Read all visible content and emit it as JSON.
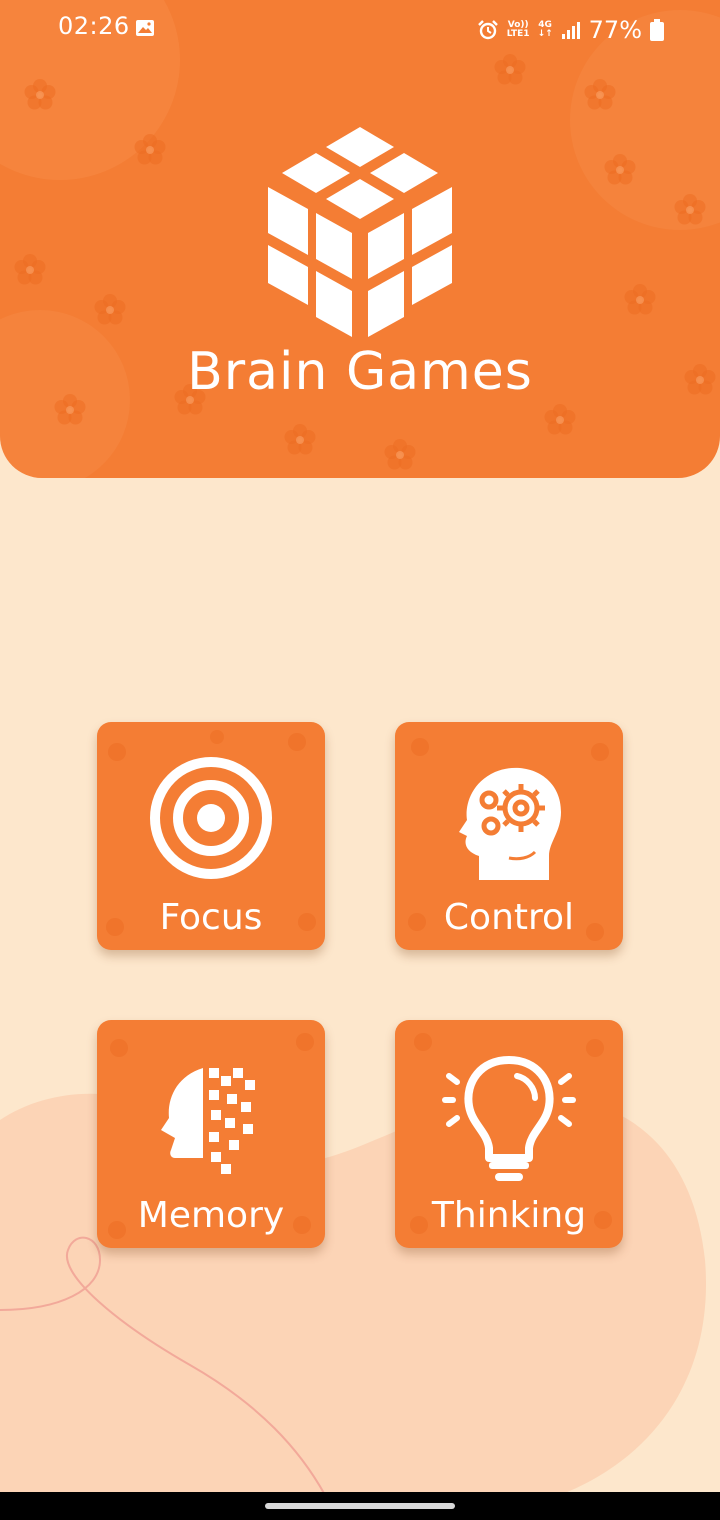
{
  "status_bar": {
    "time": "02:26",
    "volte_top": "Vo))",
    "volte_bottom": "LTE1",
    "network_top": "4G",
    "network_bottom": "↓↑",
    "battery": "77%",
    "icons": [
      "gallery-icon",
      "alarm-icon",
      "signal-icon",
      "battery-icon"
    ]
  },
  "app": {
    "title": "Brain Games",
    "logo_icon": "cube-icon"
  },
  "menu": {
    "tiles": [
      {
        "label": "Focus",
        "icon": "target-icon"
      },
      {
        "label": "Control",
        "icon": "head-gears-icon"
      },
      {
        "label": "Memory",
        "icon": "head-pixels-icon"
      },
      {
        "label": "Thinking",
        "icon": "lightbulb-icon"
      }
    ]
  },
  "colors": {
    "accent": "#f47d34",
    "background": "#fde7cc",
    "text_on_accent": "#ffffff"
  }
}
